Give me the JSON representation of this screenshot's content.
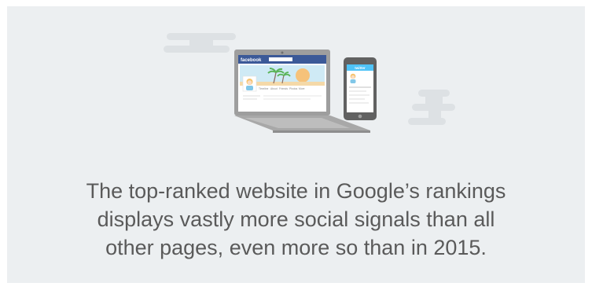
{
  "illustration": {
    "laptop_brand": "facebook",
    "laptop_tabs": [
      "Timeline",
      "About",
      "Friends",
      "Photos",
      "More"
    ],
    "phone_brand": "twitter",
    "colors": {
      "background": "#eceff1",
      "cloud": "#dde1e4",
      "laptop_body": "#9e9e9e",
      "facebook_blue": "#3b5998",
      "twitter_blue": "#4fc3f7",
      "sky": "#cfeaf5",
      "sun": "#f6c27a",
      "sand": "#f4d9a8",
      "palm": "#5bb55a"
    }
  },
  "caption": {
    "line1": "The top-ranked website in Google’s rankings",
    "line2": "displays vastly more social signals than all",
    "line3": "other pages, even more so than in 2015."
  }
}
